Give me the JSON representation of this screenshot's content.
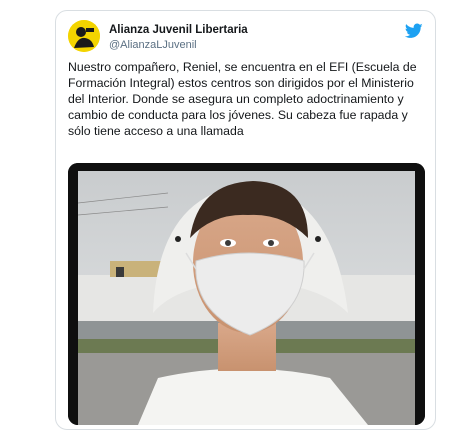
{
  "tweet": {
    "display_name": "Alianza Juvenil Libertaria",
    "handle": "@AlianzaLJuvenil",
    "text": "Nuestro compañero, Reniel, se encuentra en el EFI (Escuela de Formación Integral) estos centros son dirigidos por el Ministerio del Interior. Donde se asegura un completo adoctrinamiento y cambio de conducta para los jóvenes. Su cabeza fue rapada y sólo tiene acceso a una llamada",
    "brand_color": "#1da1f2",
    "icons": [
      "avatar-logo",
      "twitter-bird-icon"
    ]
  }
}
